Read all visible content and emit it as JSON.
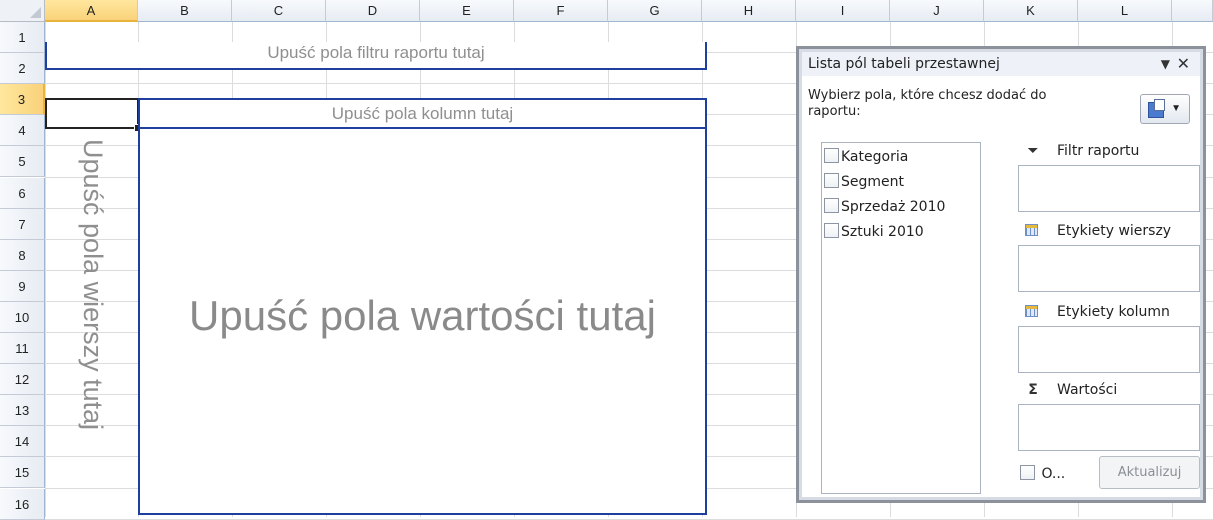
{
  "spreadsheet": {
    "columns": [
      "A",
      "B",
      "C",
      "D",
      "E",
      "F",
      "G",
      "H",
      "I",
      "J",
      "K",
      "L"
    ],
    "rows": [
      "1",
      "2",
      "3",
      "4",
      "5",
      "6",
      "7",
      "8",
      "9",
      "10",
      "11",
      "12",
      "13",
      "14",
      "15",
      "16"
    ],
    "active_column": "A",
    "active_row": "3"
  },
  "pivot": {
    "filter_drop_text": "Upuść pola filtru raportu tutaj",
    "column_drop_text": "Upuść pola kolumn tutaj",
    "row_drop_text": "Upuść pola wierszy tutaj",
    "value_drop_text": "Upuść pola wartości tutaj"
  },
  "field_list_panel": {
    "title": "Lista pól tabeli przestawnej",
    "dropdown_glyph": "▼",
    "close_glyph": "✕",
    "instruction": "Wybierz pola, które chcesz dodać do raportu:",
    "fields": [
      "Kategoria",
      "Segment",
      "Sprzedaż 2010",
      "Sztuki 2010"
    ],
    "areas": {
      "filter_label": "Filtr raportu",
      "rows_label": "Etykiety wierszy",
      "columns_label": "Etykiety kolumn",
      "values_label": "Wartości"
    },
    "defer_label": "O...",
    "update_button": "Aktualizuj"
  },
  "icons": {
    "filter": "filter-funnel-icon",
    "rows": "row-labels-icon",
    "columns": "column-labels-icon",
    "values": "sigma-icon",
    "layout": "field-list-layout-icon"
  }
}
